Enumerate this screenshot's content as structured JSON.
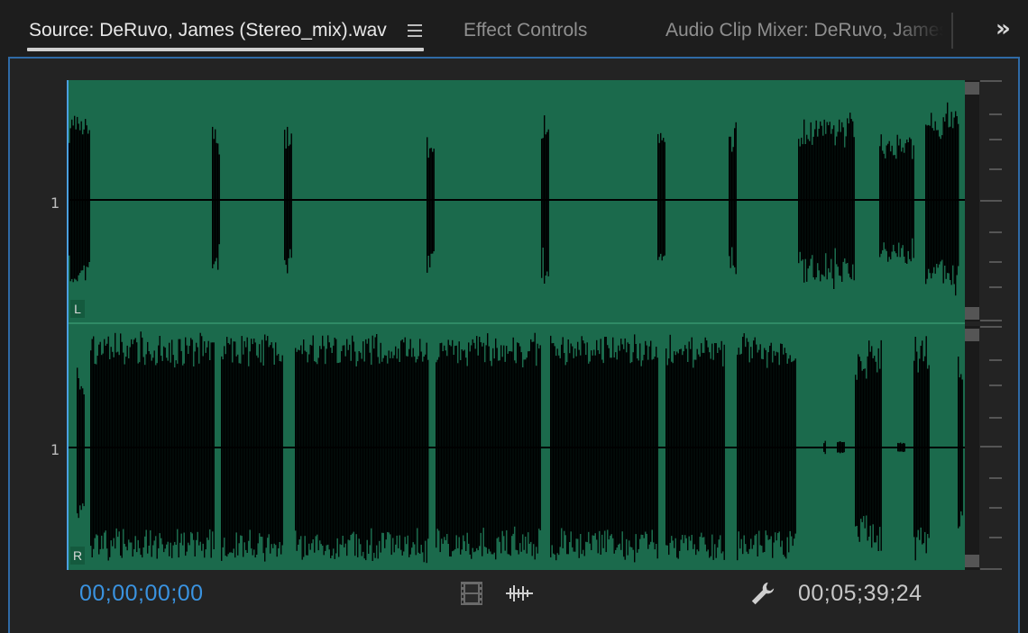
{
  "tabs": [
    {
      "label": "Source: DeRuvo, James (Stereo_mix).wav",
      "active": true
    },
    {
      "label": "Effect Controls",
      "active": false
    },
    {
      "label": "Audio Clip Mixer: DeRuvo, James",
      "active": false
    }
  ],
  "icons": {
    "tab_menu": "hamburger-menu-icon",
    "overflow": "double-chevron-right-icon",
    "insert_clip": "film-strip-icon",
    "audio_waveform": "waveform-icon",
    "settings": "wrench-icon"
  },
  "overflow_glyph": "»",
  "channels": [
    {
      "number_label": "1",
      "channel_badge": "L"
    },
    {
      "number_label": "1",
      "channel_badge": "R"
    }
  ],
  "timecode": {
    "current": "00;00;00;00",
    "duration": "00;05;39;24"
  },
  "colors": {
    "waveform_background": "#1b6a4c",
    "waveform": "#000000",
    "current_timecode": "#3a93e0",
    "panel_border": "#2f6aa6"
  }
}
